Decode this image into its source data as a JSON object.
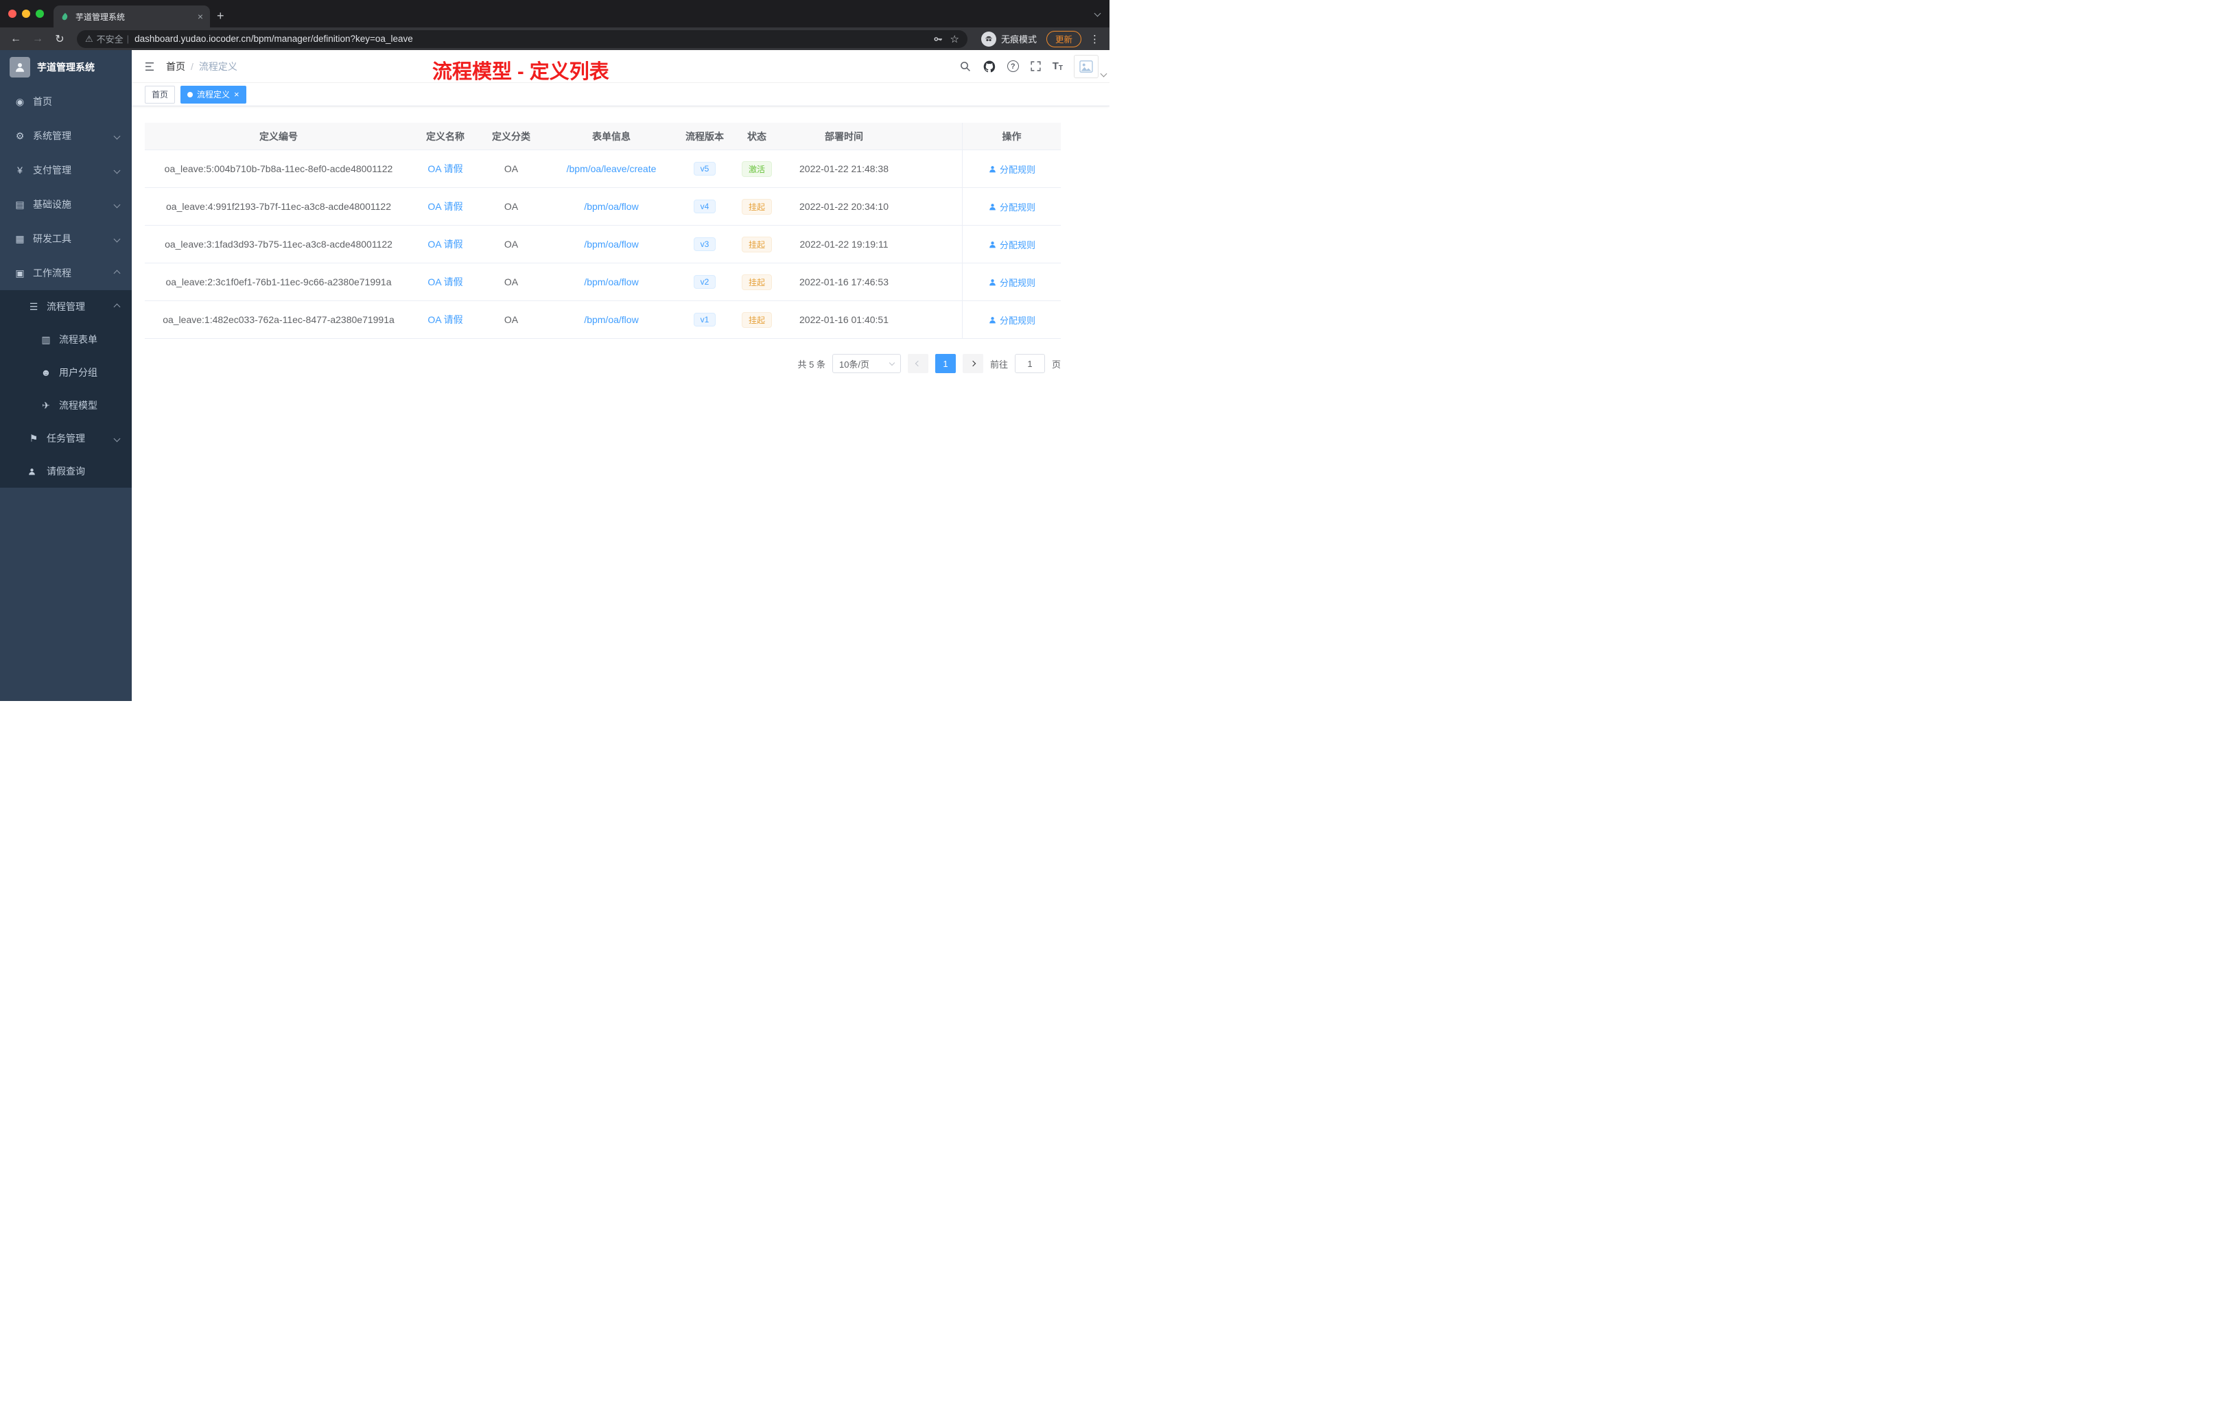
{
  "browser": {
    "tab_title": "芋道管理系统",
    "security_label": "不安全",
    "url": "dashboard.yudao.iocoder.cn/bpm/manager/definition?key=oa_leave",
    "incognito_label": "无痕模式",
    "update_label": "更新"
  },
  "icons": {
    "back": "←",
    "forward": "→",
    "reload": "↻",
    "warning": "⚠",
    "divider": "|",
    "star": "☆",
    "dots": "⋮",
    "plus": "+",
    "close": "×",
    "question": "?",
    "t_large": "T",
    "t_small": "T",
    "menu_dashboard": "◉",
    "menu_system": "⚙",
    "menu_pay": "¥",
    "menu_infra": "▤",
    "menu_dev": "▦",
    "menu_workflow": "▣",
    "menu_process": "☰",
    "menu_form": "▥",
    "menu_users": "☻",
    "menu_model": "✈",
    "menu_task": "⚑"
  },
  "sidebar": {
    "logo_title": "芋道管理系统",
    "items": [
      {
        "label": "首页"
      },
      {
        "label": "系统管理"
      },
      {
        "label": "支付管理"
      },
      {
        "label": "基础设施"
      },
      {
        "label": "研发工具"
      },
      {
        "label": "工作流程"
      },
      {
        "label": "流程管理"
      },
      {
        "label": "流程表单"
      },
      {
        "label": "用户分组"
      },
      {
        "label": "流程模型"
      },
      {
        "label": "任务管理"
      },
      {
        "label": "请假查询"
      }
    ]
  },
  "header": {
    "breadcrumb_home": "首页",
    "breadcrumb_sep": "/",
    "breadcrumb_current": "流程定义",
    "annotation": "流程模型 - 定义列表"
  },
  "tags": {
    "items": [
      {
        "label": "首页"
      },
      {
        "label": "流程定义"
      }
    ]
  },
  "table": {
    "columns": [
      "定义编号",
      "定义名称",
      "定义分类",
      "表单信息",
      "流程版本",
      "状态",
      "部署时间",
      "操作"
    ],
    "rows": [
      {
        "id": "oa_leave:5:004b710b-7b8a-11ec-8ef0-acde48001122",
        "name": "OA 请假",
        "category": "OA",
        "form": "/bpm/oa/leave/create",
        "version": "v5",
        "status": "激活",
        "status_type": "active",
        "time": "2022-01-22 21:48:38",
        "action": "分配规则"
      },
      {
        "id": "oa_leave:4:991f2193-7b7f-11ec-a3c8-acde48001122",
        "name": "OA 请假",
        "category": "OA",
        "form": "/bpm/oa/flow",
        "version": "v4",
        "status": "挂起",
        "status_type": "suspended",
        "time": "2022-01-22 20:34:10",
        "action": "分配规则"
      },
      {
        "id": "oa_leave:3:1fad3d93-7b75-11ec-a3c8-acde48001122",
        "name": "OA 请假",
        "category": "OA",
        "form": "/bpm/oa/flow",
        "version": "v3",
        "status": "挂起",
        "status_type": "suspended",
        "time": "2022-01-22 19:19:11",
        "action": "分配规则"
      },
      {
        "id": "oa_leave:2:3c1f0ef1-76b1-11ec-9c66-a2380e71991a",
        "name": "OA 请假",
        "category": "OA",
        "form": "/bpm/oa/flow",
        "version": "v2",
        "status": "挂起",
        "status_type": "suspended",
        "time": "2022-01-16 17:46:53",
        "action": "分配规则"
      },
      {
        "id": "oa_leave:1:482ec033-762a-11ec-8477-a2380e71991a",
        "name": "OA 请假",
        "category": "OA",
        "form": "/bpm/oa/flow",
        "version": "v1",
        "status": "挂起",
        "status_type": "suspended",
        "time": "2022-01-16 01:40:51",
        "action": "分配规则"
      }
    ]
  },
  "pagination": {
    "total": "共 5 条",
    "page_size": "10条/页",
    "current": "1",
    "goto_label": "前往",
    "goto_value": "1",
    "page_unit": "页"
  }
}
